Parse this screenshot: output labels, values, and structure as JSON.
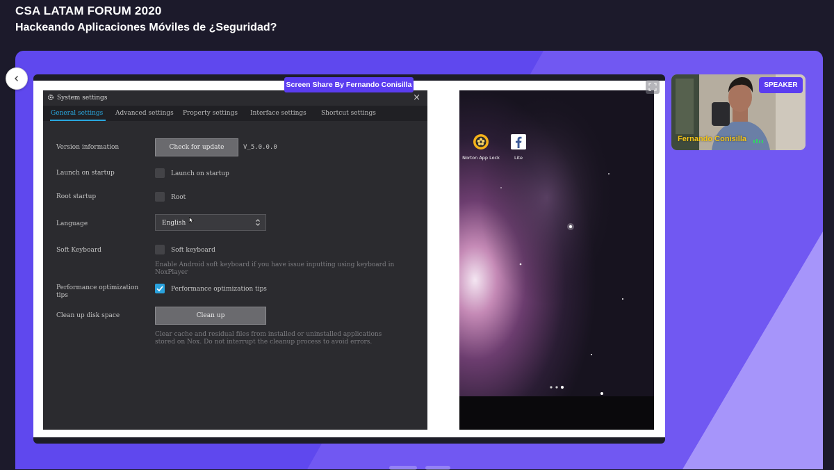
{
  "event": {
    "title": "CSA LATAM FORUM 2020",
    "subtitle": "Hackeando Aplicaciones Móviles de ¿Seguridad?"
  },
  "share_badge": "Screen Share By Fernando Conisilla",
  "speaker": {
    "badge": "SPEAKER",
    "name": "Fernando Conisilla"
  },
  "colors": {
    "stage_purple": "#5f48ee",
    "badge_purple": "#5b3df0",
    "speaker_name": "#f3c519",
    "tab_active": "#29a8e0"
  },
  "dialog": {
    "title": "System settings",
    "close_label": "×",
    "tabs": [
      {
        "label": "General settings",
        "active": true
      },
      {
        "label": "Advanced settings",
        "active": false
      },
      {
        "label": "Property settings",
        "active": false
      },
      {
        "label": "Interface settings",
        "active": false
      },
      {
        "label": "Shortcut settings",
        "active": false
      }
    ],
    "version": {
      "label": "Version information",
      "button": "Check for update",
      "value": "V_5.0.0.0"
    },
    "launch": {
      "label": "Launch on startup",
      "checkbox_label": "Launch on startup",
      "checked": false
    },
    "root": {
      "label": "Root startup",
      "checkbox_label": "Root",
      "checked": false
    },
    "language": {
      "label": "Language",
      "value": "English"
    },
    "soft_keyboard": {
      "label": "Soft Keyboard",
      "checkbox_label": "Soft keyboard",
      "checked": false,
      "help_line1": "Enable Android soft keyboard if you have issue inputting using keyboard in",
      "help_line2": "NoxPlayer"
    },
    "performance": {
      "label_line1": "Performance optimization",
      "label_line2": "tips",
      "checkbox_label": "Performance optimization tips",
      "checked": true
    },
    "cleanup": {
      "label": "Clean up disk space",
      "button": "Clean up",
      "help_line1": "Clear cache and residual files from installed or uninstalled applications",
      "help_line2": "stored on Nox. Do not interrupt the cleanup process to avoid errors."
    }
  },
  "phone": {
    "apps": [
      {
        "label": "Norton App Lock",
        "icon": "norton-app-lock-icon"
      },
      {
        "label": "Lite",
        "icon": "facebook-lite-icon"
      }
    ]
  }
}
